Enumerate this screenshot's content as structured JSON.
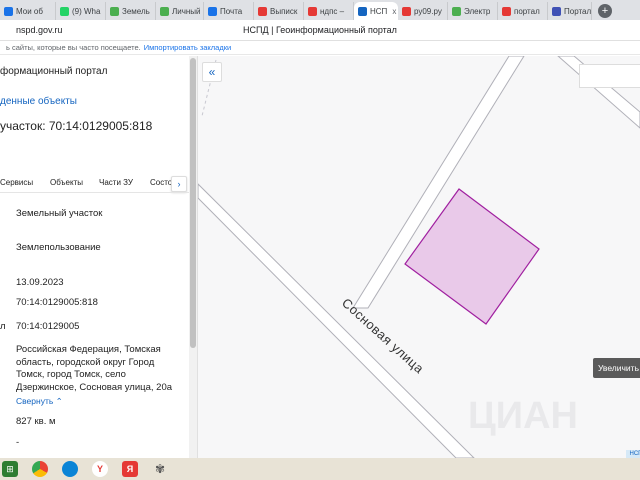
{
  "browser": {
    "tabs": [
      {
        "label": "Мои об",
        "color": "#1a73e8"
      },
      {
        "label": "(9) Wha",
        "color": "#25d366"
      },
      {
        "label": "Земель",
        "color": "#4caf50"
      },
      {
        "label": "Личный",
        "color": "#4caf50"
      },
      {
        "label": "Почта",
        "color": "#1a73e8"
      },
      {
        "label": "Выписк",
        "color": "#e53935"
      },
      {
        "label": "ндпс –",
        "color": "#e53935"
      },
      {
        "label": "НСП",
        "color": "#1565c0",
        "close": "x"
      },
      {
        "label": "ру09.ру",
        "color": "#e53935"
      },
      {
        "label": "Электр",
        "color": "#4caf50"
      },
      {
        "label": "портал",
        "color": "#e53935"
      },
      {
        "label": "Портал",
        "color": "#3f51b5"
      }
    ],
    "new_tab": "+",
    "url": "nspd.gov.ru",
    "page_title": "НСПД | Геоинформационный портал",
    "bookmarks_text": "ь сайты, которые вы часто посещаете.",
    "bookmarks_link": "Импортировать закладки"
  },
  "panel": {
    "portal_name": "формационный портал",
    "found_link": "денные объекты",
    "parcel_title": "участок: 70:14:0129005:818",
    "tabs": [
      "Сервисы",
      "Объекты",
      "Части ЗУ",
      "Состо"
    ],
    "tabs_next": "›",
    "fields": {
      "type": "Земельный участок",
      "category": "Землепользование",
      "date": "13.09.2023",
      "cad_number": "70:14:0129005:818",
      "quarter_prefix": "л",
      "quarter": "70:14:0129005",
      "address": "Российская Федерация, Томская область, городской округ Город Томск, город Томск, село Дзержинское, Сосновая улица, 20а",
      "collapse": "Свернуть",
      "area": "827 кв. м",
      "dash": "-"
    }
  },
  "map": {
    "back": "«",
    "street": "Сосновая улица",
    "zoom_tooltip": "Увеличить",
    "watermark": "ЦИАН",
    "badge": "НСП",
    "parcel_fill": "#e9c9e9",
    "parcel_stroke": "#a020a0"
  },
  "taskbar": {
    "yandex1": "Y",
    "yandex2": "Я"
  }
}
